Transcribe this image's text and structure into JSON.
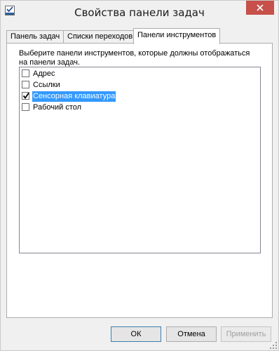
{
  "window": {
    "title": "Свойства панели задач"
  },
  "tabs": [
    {
      "label": "Панель задач"
    },
    {
      "label": "Списки переходов"
    },
    {
      "label": "Панели инструментов"
    }
  ],
  "panel": {
    "description_line1": "Выберите панели инструментов, которые должны отображаться",
    "description_line2": "на панели задач."
  },
  "toolbars": [
    {
      "label": "Адрес",
      "checked": false,
      "selected": false
    },
    {
      "label": "Ссылки",
      "checked": false,
      "selected": false
    },
    {
      "label": "Сенсорная клавиатура",
      "checked": true,
      "selected": true
    },
    {
      "label": "Рабочий стол",
      "checked": false,
      "selected": false
    }
  ],
  "buttons": {
    "ok": "ОК",
    "cancel": "Отмена",
    "apply": "Применить"
  },
  "colors": {
    "selection": "#3399ff",
    "close_button": "#c7504a",
    "window_bg": "#f0f0f0"
  },
  "icons": {
    "app": "taskbar-properties-icon",
    "close": "close-icon",
    "check": "checkmark-icon",
    "resize": "resize-grip-icon"
  }
}
